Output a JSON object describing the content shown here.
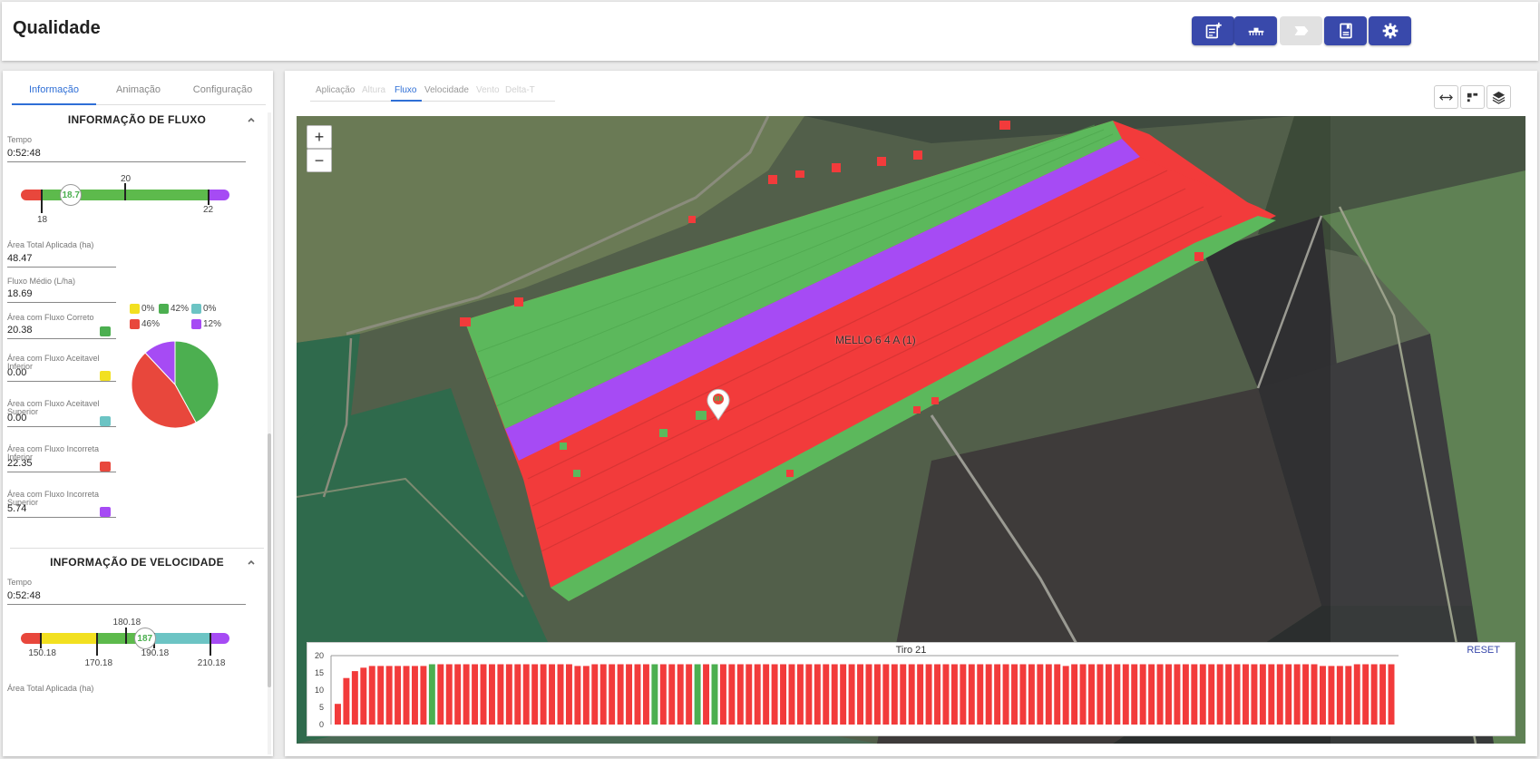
{
  "header": {
    "title": "Qualidade",
    "buttons": [
      {
        "icon": "add-note-icon",
        "enabled": true
      },
      {
        "icon": "spray-bar-icon",
        "enabled": true
      },
      {
        "icon": "label-icon",
        "enabled": false
      },
      {
        "icon": "report-icon",
        "enabled": true
      },
      {
        "icon": "gear-icon",
        "enabled": true
      }
    ]
  },
  "left_panel": {
    "tabs": [
      "Informação",
      "Animação",
      "Configuração"
    ],
    "active_tab": "Informação",
    "flow": {
      "title": "INFORMAÇÃO DE FLUXO",
      "time_label": "Tempo",
      "time_value": "0:52:48",
      "gauge": {
        "low": "18",
        "target": "20",
        "high": "22",
        "current": "18.7",
        "min": 17.5,
        "max": 22.5,
        "low_value": 18,
        "target_value": 20,
        "high_value": 22,
        "current_value": 18.7
      },
      "fields": [
        {
          "label": "Área Total Aplicada (ha)",
          "value": "48.47",
          "color": ""
        },
        {
          "label": "Fluxo Médio (L/ha)",
          "value": "18.69",
          "color": ""
        },
        {
          "label": "Área com Fluxo Correto",
          "value": "20.38",
          "color": "#4caf50"
        },
        {
          "label": "Área com Fluxo Aceitavel Inferior",
          "value": "0.00",
          "color": "#f2e020"
        },
        {
          "label": "Área com Fluxo Aceitavel Superior",
          "value": "0.00",
          "color": "#6cc4c4"
        },
        {
          "label": "Área com Fluxo Incorreta Inferior",
          "value": "22.35",
          "color": "#e8473c"
        },
        {
          "label": "Área com Fluxo Incorreta Superior",
          "value": "5.74",
          "color": "#a64bf4"
        }
      ],
      "pie": {
        "legend": [
          {
            "label": "0%",
            "color": "#f2e020"
          },
          {
            "label": "42%",
            "color": "#4caf50"
          },
          {
            "label": "0%",
            "color": "#6cc4c4"
          },
          {
            "label": "46%",
            "color": "#e8473c"
          },
          {
            "label": "12%",
            "color": "#a64bf4"
          }
        ],
        "slices": [
          {
            "color": "#4caf50",
            "value": 42
          },
          {
            "color": "#e8473c",
            "value": 46
          },
          {
            "color": "#a64bf4",
            "value": 12
          }
        ]
      }
    },
    "speed": {
      "title": "INFORMAÇÃO DE VELOCIDADE",
      "time_label": "Tempo",
      "time_value": "0:52:48",
      "gauge": {
        "labels": [
          "150.18",
          "170.18",
          "180.18",
          "190.18",
          "210.18"
        ],
        "current": "187",
        "min": 143,
        "max": 217,
        "values": [
          150.18,
          170.18,
          180.18,
          190.18,
          210.18
        ],
        "current_value": 187
      },
      "next_label": "Área Total Aplicada (ha)"
    }
  },
  "map_view": {
    "view_tabs": [
      {
        "label": "Aplicação",
        "state": "normal"
      },
      {
        "label": "Altura",
        "state": "disabled"
      },
      {
        "label": "Fluxo",
        "state": "active"
      },
      {
        "label": "Velocidade",
        "state": "normal"
      },
      {
        "label": "Vento",
        "state": "disabled"
      },
      {
        "label": "Delta-T",
        "state": "disabled"
      }
    ],
    "tool_icons": [
      "arrows-horizontal-icon",
      "grid-icon",
      "layers-icon"
    ],
    "zoom_in": "+",
    "zoom_out": "−",
    "field_label": "MELLO 6 4 A (1)",
    "chart": {
      "title": "Tiro 21",
      "reset": "RESET",
      "y_ticks": [
        0,
        5,
        10,
        15,
        20
      ],
      "ylim": [
        0,
        20
      ],
      "colors": {
        "correct": "#4caf50",
        "incorrect": "#f23b3b"
      }
    }
  },
  "chart_data": {
    "type": "bar",
    "title": "Tiro 21",
    "xlabel": "",
    "ylabel": "",
    "ylim": [
      0,
      20
    ],
    "y_ticks": [
      0,
      5,
      10,
      15,
      20
    ],
    "values": [
      6,
      13.5,
      15.5,
      16.5,
      17,
      17,
      17,
      17,
      17,
      17,
      17,
      17.5,
      17.5,
      17.5,
      17.5,
      17.5,
      17.5,
      17.5,
      17.5,
      17.5,
      17.5,
      17.5,
      17.5,
      17.5,
      17.5,
      17.5,
      17.5,
      17.5,
      17,
      17,
      17.5,
      17.5,
      17.5,
      17.5,
      17.5,
      17.5,
      17.5,
      17.5,
      17.5,
      17.5,
      17.5,
      17.5,
      17.5,
      17.5,
      17.5,
      17.5,
      17.5,
      17.5,
      17.5,
      17.5,
      17.5,
      17.5,
      17.5,
      17.5,
      17.5,
      17.5,
      17.5,
      17.5,
      17.5,
      17.5,
      17.5,
      17.5,
      17.5,
      17.5,
      17.5,
      17.5,
      17.5,
      17.5,
      17.5,
      17.5,
      17.5,
      17.5,
      17.5,
      17.5,
      17.5,
      17.5,
      17.5,
      17.5,
      17.5,
      17.5,
      17.5,
      17.5,
      17.5,
      17.5,
      17.5,
      17,
      17.5,
      17.5,
      17.5,
      17.5,
      17.5,
      17.5,
      17.5,
      17.5,
      17.5,
      17.5,
      17.5,
      17.5,
      17.5,
      17.5,
      17.5,
      17.5,
      17.5,
      17.5,
      17.5,
      17.5,
      17.5,
      17.5,
      17.5,
      17.5,
      17.5,
      17.5,
      17.5,
      17.5,
      17.5,
      17,
      17,
      17,
      17,
      17.5,
      17.5,
      17.5,
      17.5,
      17.5
    ],
    "status": [
      "r",
      "r",
      "r",
      "r",
      "r",
      "r",
      "r",
      "r",
      "r",
      "r",
      "r",
      "g",
      "r",
      "r",
      "r",
      "r",
      "r",
      "r",
      "r",
      "r",
      "r",
      "r",
      "r",
      "r",
      "r",
      "r",
      "r",
      "r",
      "r",
      "r",
      "r",
      "r",
      "r",
      "r",
      "r",
      "r",
      "r",
      "g",
      "r",
      "r",
      "r",
      "r",
      "g",
      "r",
      "g",
      "r",
      "r",
      "r",
      "r",
      "r",
      "r",
      "r",
      "r",
      "r",
      "r",
      "r",
      "r",
      "r",
      "r",
      "r",
      "r",
      "r",
      "r",
      "r",
      "r",
      "r",
      "r",
      "r",
      "r",
      "r",
      "r",
      "r",
      "r",
      "r",
      "r",
      "r",
      "r",
      "r",
      "r",
      "r",
      "r",
      "r",
      "r",
      "r",
      "r",
      "r",
      "r",
      "r",
      "r",
      "r",
      "r",
      "r",
      "r",
      "r",
      "r",
      "r",
      "r",
      "r",
      "r",
      "r",
      "r",
      "r",
      "r",
      "r",
      "r",
      "r",
      "r",
      "r",
      "r",
      "r",
      "r",
      "r",
      "r",
      "r",
      "r",
      "r",
      "r",
      "r",
      "r",
      "r",
      "r",
      "r",
      "r"
    ]
  }
}
